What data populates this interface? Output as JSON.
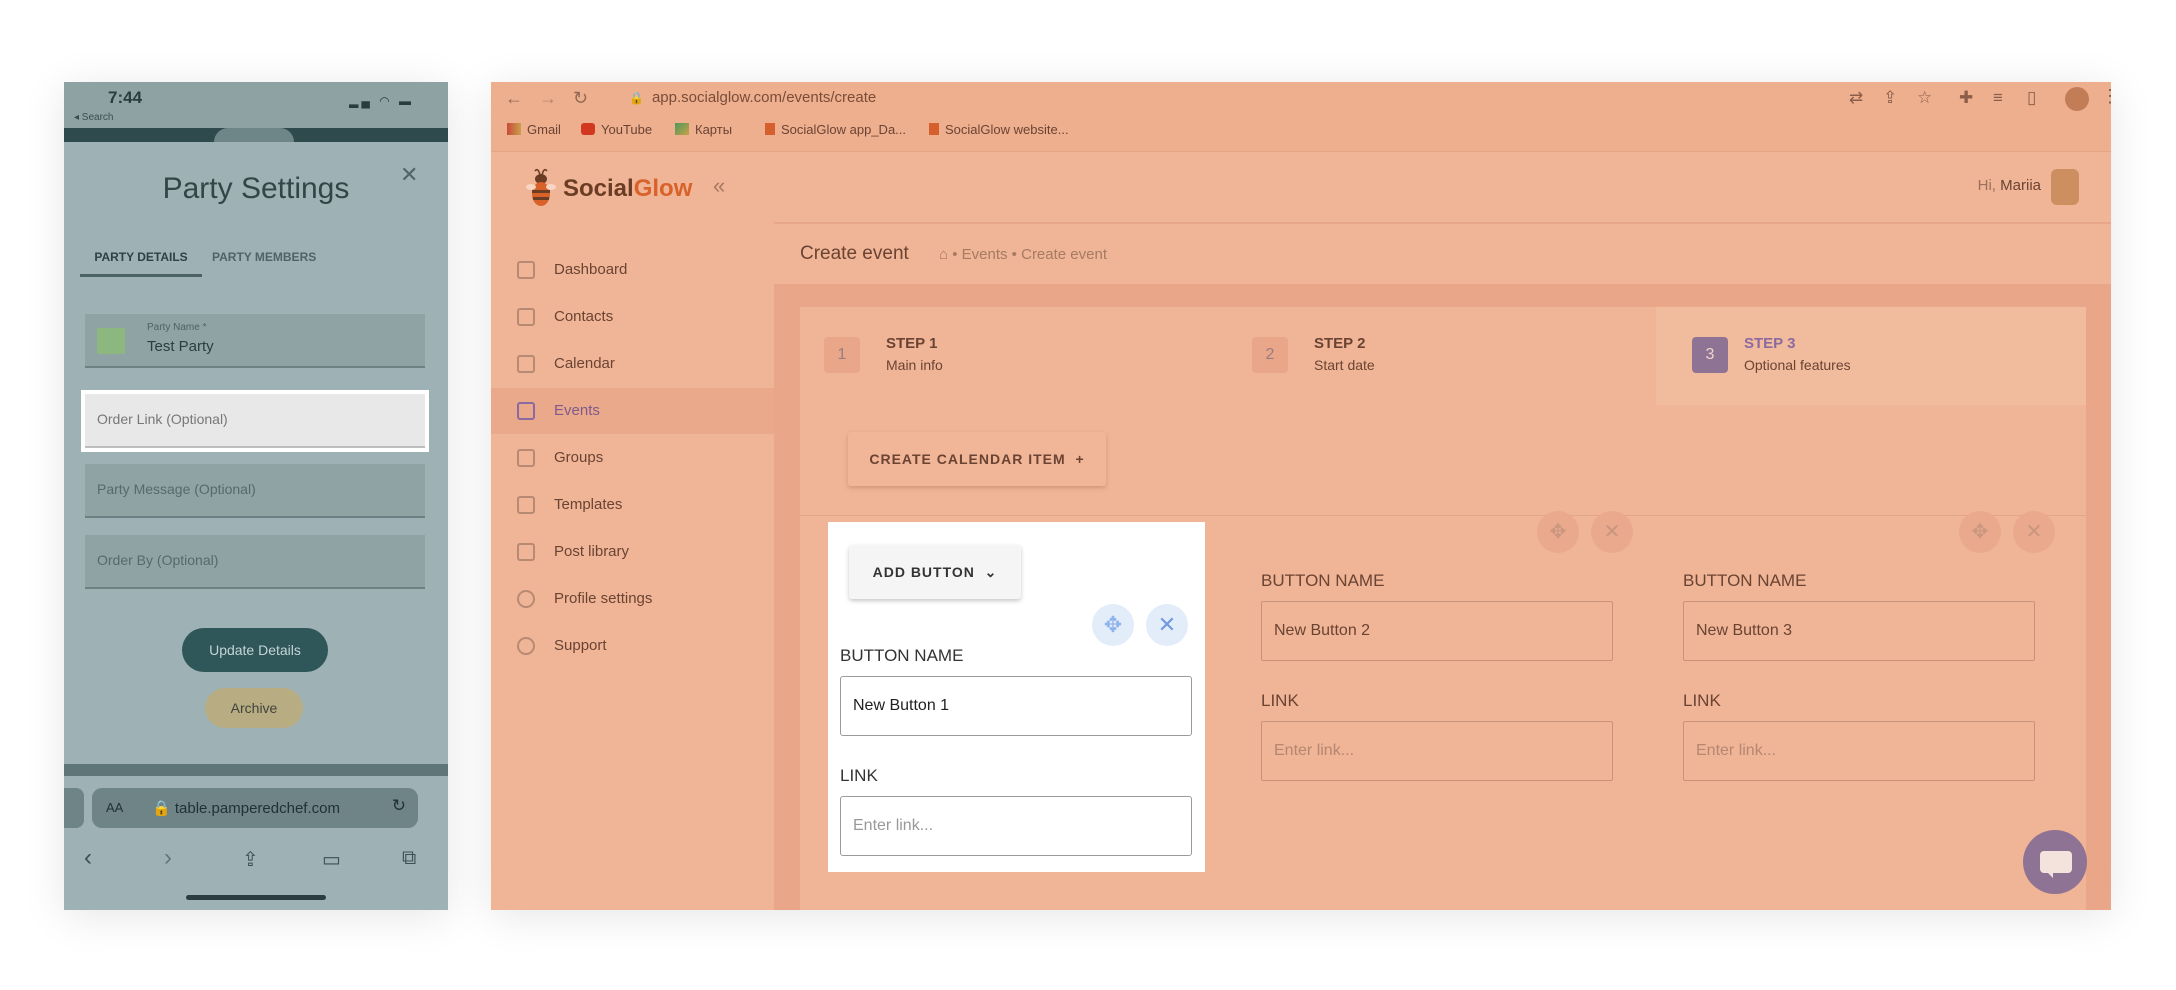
{
  "phone": {
    "time": "7:44",
    "back_label": "◂ Search",
    "title": "Party Settings",
    "tabs": [
      "PARTY DETAILS",
      "PARTY MEMBERS"
    ],
    "party_name_label": "Party Name *",
    "party_name_value": "Test Party",
    "order_link_placeholder": "Order Link (Optional)",
    "party_message_placeholder": "Party Message (Optional)",
    "order_by_placeholder": "Order By (Optional)",
    "update_button": "Update Details",
    "archive_button": "Archive",
    "url_aa": "AA",
    "url": "table.pamperedchef.com"
  },
  "browser": {
    "url": "app.socialglow.com/events/create",
    "bookmarks": [
      "Gmail",
      "YouTube",
      "Карты",
      "SocialGlow app_Da...",
      "SocialGlow website..."
    ]
  },
  "sidebar": {
    "logo_social": "Social",
    "logo_glow": "Glow",
    "items": [
      {
        "label": "Dashboard",
        "icon": "home-icon"
      },
      {
        "label": "Contacts",
        "icon": "contacts-icon"
      },
      {
        "label": "Calendar",
        "icon": "calendar-icon"
      },
      {
        "label": "Events",
        "icon": "events-icon"
      },
      {
        "label": "Groups",
        "icon": "groups-icon"
      },
      {
        "label": "Templates",
        "icon": "templates-icon"
      },
      {
        "label": "Post library",
        "icon": "post-library-icon"
      },
      {
        "label": "Profile settings",
        "icon": "gear-icon"
      },
      {
        "label": "Support",
        "icon": "support-icon"
      }
    ],
    "active_index": 3
  },
  "main": {
    "greeting_prefix": "Hi,",
    "user_name": "Mariia",
    "page_title": "Create event",
    "breadcrumb": [
      "Events",
      "Create event"
    ],
    "steps": [
      {
        "num": "1",
        "title": "STEP 1",
        "sub": "Main info"
      },
      {
        "num": "2",
        "title": "STEP 2",
        "sub": "Start date"
      },
      {
        "num": "3",
        "title": "STEP 3",
        "sub": "Optional features"
      }
    ],
    "create_calendar_item": "CREATE CALENDAR ITEM",
    "add_button": "ADD BUTTON",
    "button_name_label": "BUTTON NAME",
    "link_label": "LINK",
    "link_placeholder": "Enter link...",
    "buttons": [
      {
        "name": "New Button 1"
      },
      {
        "name": "New Button 2"
      },
      {
        "name": "New Button 3"
      }
    ]
  },
  "colors": {
    "brand_orange": "#d9622a",
    "accent_purple": "#8f7394",
    "highlight_blue": "#90b4ec"
  }
}
